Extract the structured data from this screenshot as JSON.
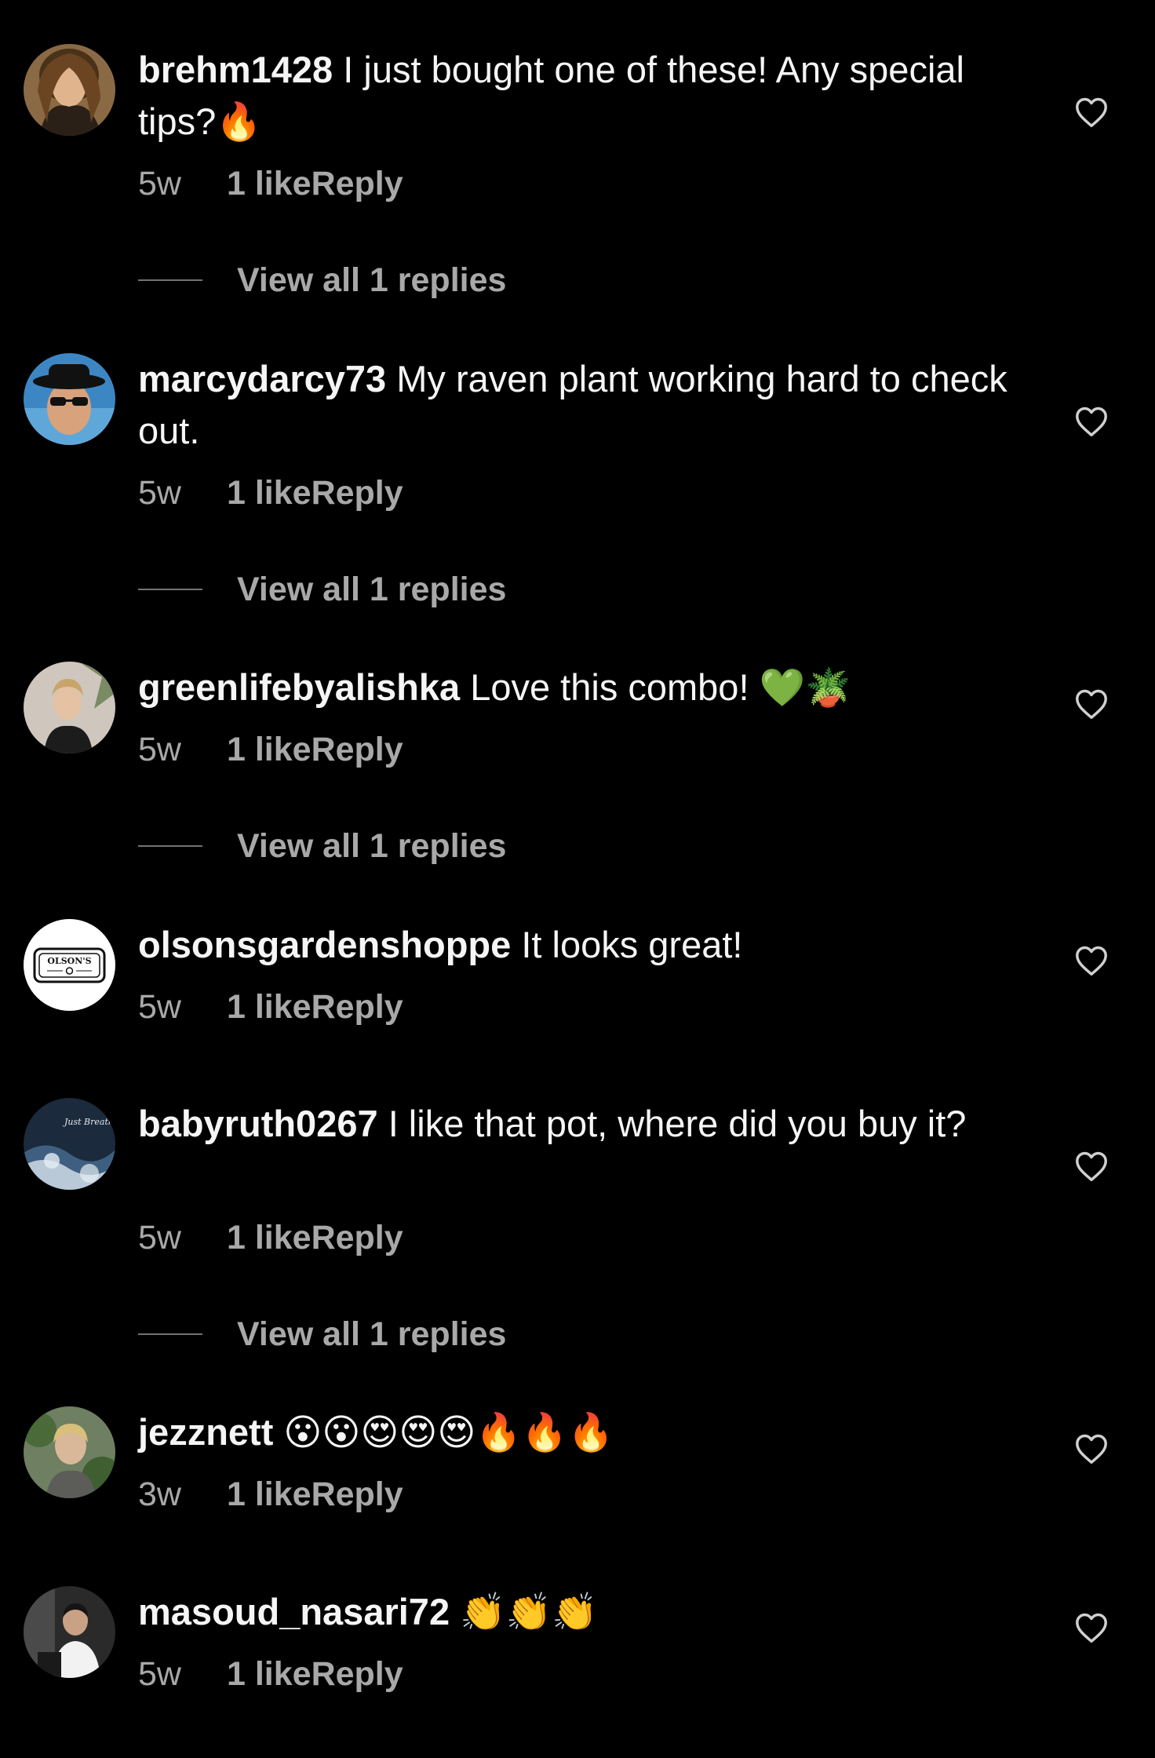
{
  "colors": {
    "background": "#000000",
    "text": "#f5f5f5",
    "secondary_text": "#a8a8a8",
    "reply_line": "#737373"
  },
  "icons": {
    "like": "heart-outline-icon"
  },
  "comments": [
    {
      "username": "brehm1428",
      "text": "I just bought one of these! Any special tips?",
      "emoji": "🔥",
      "age": "5w",
      "likes": "1 like",
      "reply": "Reply",
      "view_replies": "View all 1 replies"
    },
    {
      "username": "marcydarcy73",
      "text": "My raven plant working hard to check out.",
      "emoji": "",
      "age": "5w",
      "likes": "1 like",
      "reply": "Reply",
      "view_replies": "View all 1 replies"
    },
    {
      "username": "greenlifebyalishka",
      "text": "Love this combo!",
      "emoji": "💚🪴",
      "age": "5w",
      "likes": "1 like",
      "reply": "Reply",
      "view_replies": "View all 1 replies"
    },
    {
      "username": "olsonsgardenshoppe",
      "text": "It looks great!",
      "emoji": "",
      "age": "5w",
      "likes": "1 like",
      "reply": "Reply",
      "avatar_logo_text": "OLSON'S"
    },
    {
      "username": "babyruth0267",
      "text": "I like that pot, where did you buy it?",
      "emoji": "",
      "age": "5w",
      "likes": "1 like",
      "reply": "Reply",
      "view_replies": "View all 1 replies",
      "avatar_script_text": "Just Breathe"
    },
    {
      "username": "jezznett",
      "text": "",
      "emoji": "😮😮😍😍😍🔥🔥🔥",
      "age": "3w",
      "likes": "1 like",
      "reply": "Reply"
    },
    {
      "username": "masoud_nasari72",
      "text": "",
      "emoji": "👏👏👏",
      "age": "5w",
      "likes": "1 like",
      "reply": "Reply"
    }
  ]
}
